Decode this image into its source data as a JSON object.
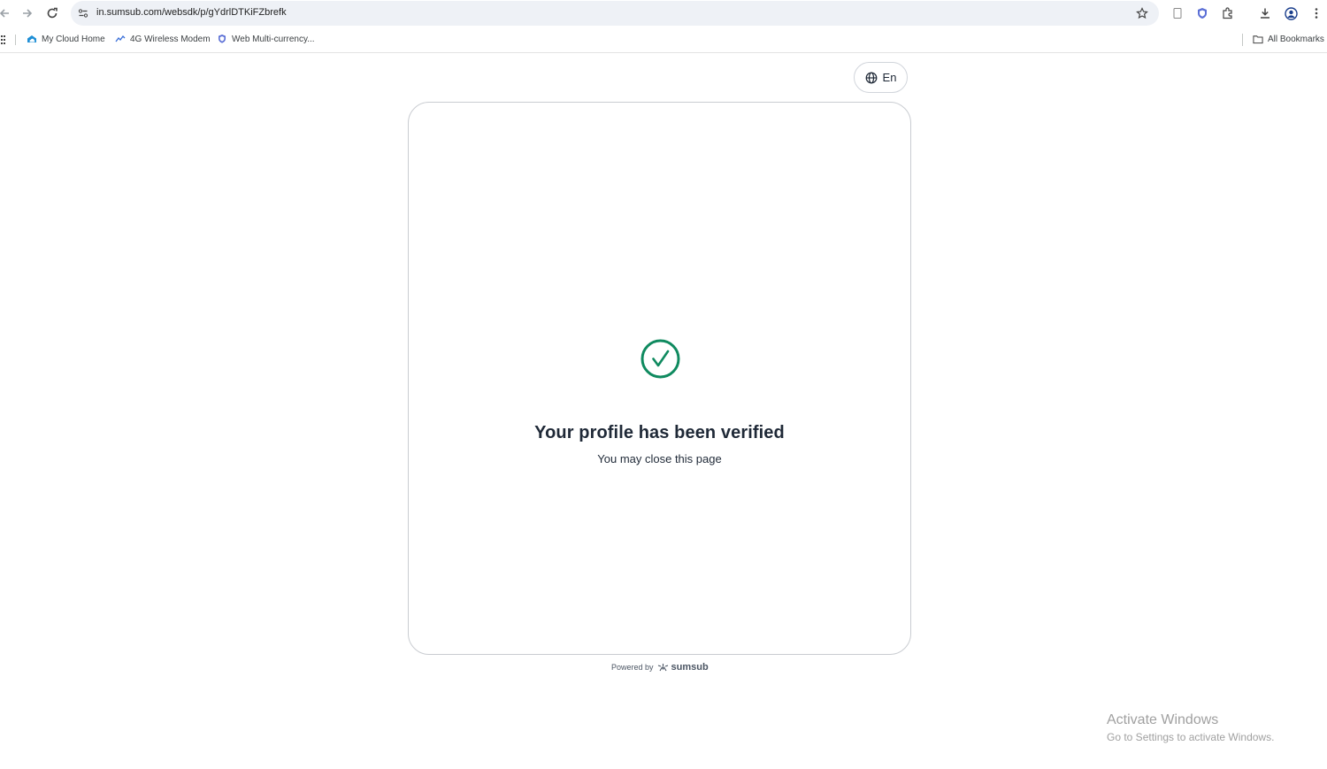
{
  "browser": {
    "url": "in.sumsub.com/websdk/p/gYdrlDTKiFZbrefk",
    "bookmarks": [
      {
        "label": "My Cloud Home",
        "icon": "cloud-icon"
      },
      {
        "label": "4G Wireless Modem",
        "icon": "modem-icon"
      },
      {
        "label": "Web Multi-currency...",
        "icon": "shield-icon"
      }
    ],
    "all_bookmarks_label": "All Bookmarks"
  },
  "language": {
    "label": "En",
    "icon": "globe-icon"
  },
  "verification": {
    "icon": "check-circle-icon",
    "title": "Your profile has been verified",
    "subtitle": "You may close this page"
  },
  "footer": {
    "powered_by": "Powered by",
    "brand": "sumsub"
  },
  "watermark": {
    "line1": "Activate Windows",
    "line2": "Go to Settings to activate Windows."
  },
  "colors": {
    "accent": "#0f8a5f",
    "card_border": "#c9ccd1",
    "text": "#1f2937"
  }
}
